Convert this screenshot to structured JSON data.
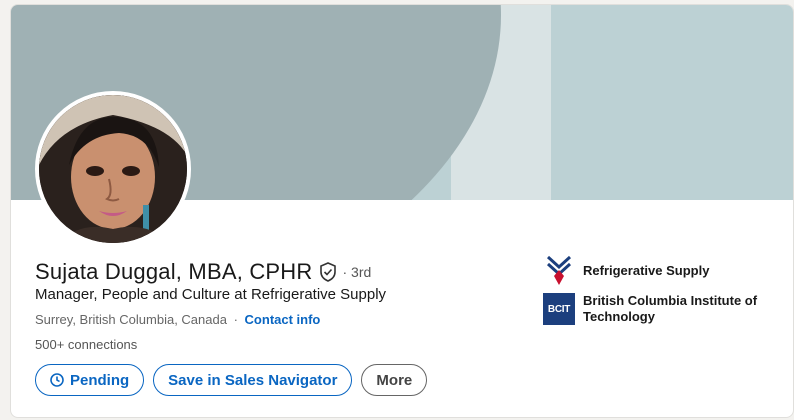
{
  "profile": {
    "name": "Sujata Duggal, MBA, CPHR",
    "degree": "· 3rd",
    "headline": "Manager, People and Culture at Refrigerative Supply",
    "location": "Surrey, British Columbia, Canada",
    "separator": "·",
    "contact_label": "Contact info",
    "connections": "500+ connections"
  },
  "actions": {
    "pending_label": "Pending",
    "sales_nav_label": "Save in Sales Navigator",
    "more_label": "More"
  },
  "organizations": [
    {
      "name": "Refrigerative Supply",
      "icon": "refrigerative-supply-logo"
    },
    {
      "name": "British Columbia Institute of Technology",
      "icon": "bcit-logo",
      "logo_text": "BCIT"
    }
  ],
  "colors": {
    "link": "#0a66c2",
    "banner": "#bcd1d4",
    "banner_arc": "#9fb1b4"
  }
}
